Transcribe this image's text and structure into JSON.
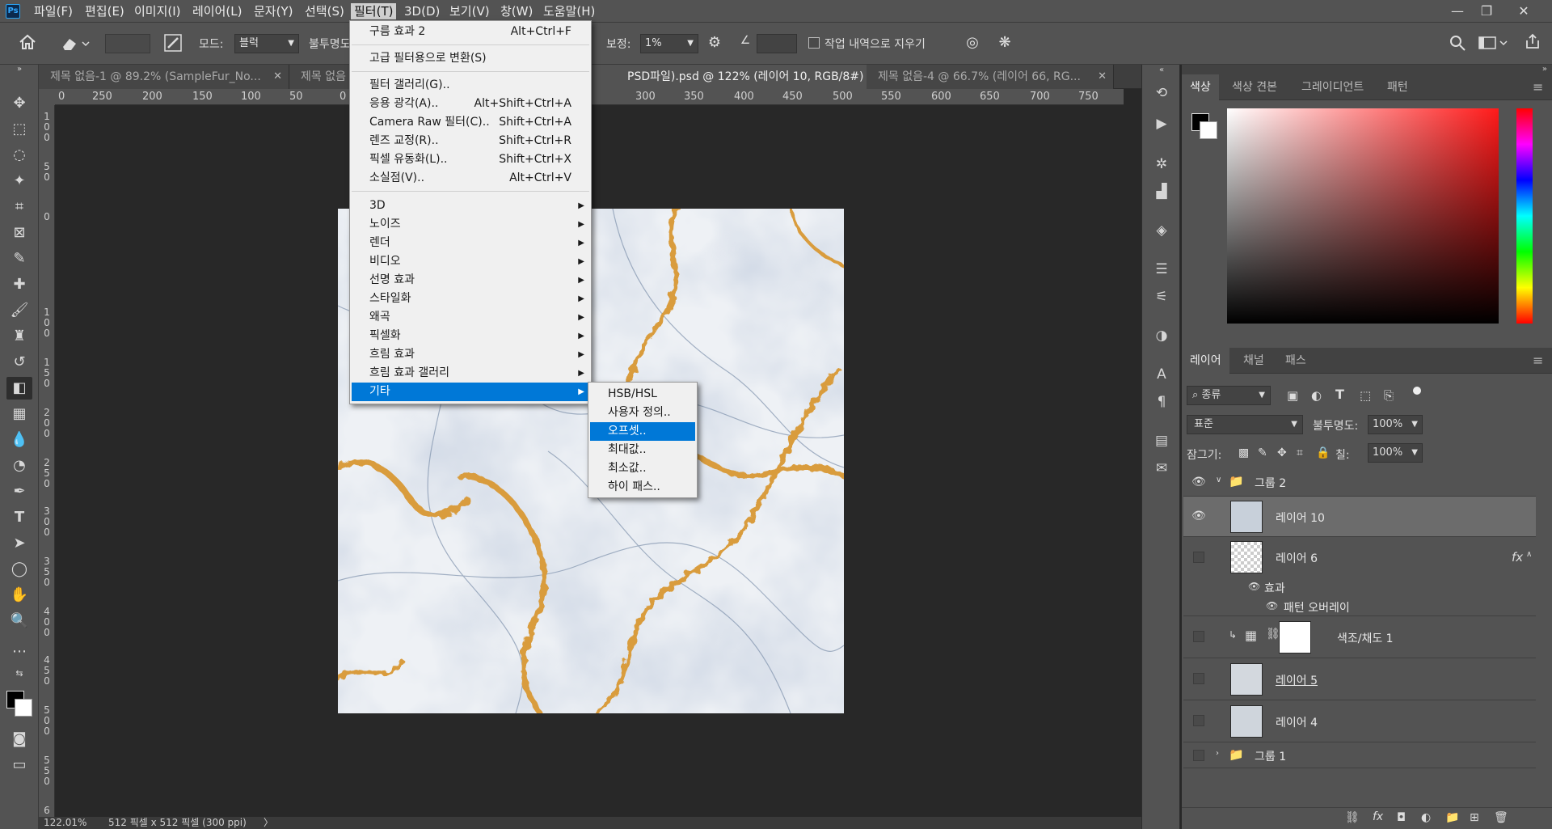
{
  "app": {
    "logo": "Ps"
  },
  "menubar": {
    "items": [
      "파일(F)",
      "편집(E)",
      "이미지(I)",
      "레이어(L)",
      "문자(Y)",
      "선택(S)",
      "필터(T)",
      "3D(D)",
      "보기(V)",
      "창(W)",
      "도움말(H)"
    ],
    "active_index": 6
  },
  "window_controls": {
    "minimize": "—",
    "restore": "❐",
    "close": "✕"
  },
  "options": {
    "mode_label": "모드:",
    "mode_value": "블럭",
    "opacity_label": "불투명도",
    "smoothing_label": "보정:",
    "smoothing_value": "1%",
    "erase_history_label": "작업 내역으로 지우기"
  },
  "tabs": [
    {
      "label": "제목 없음-1 @ 89.2% (SampleFur_No...",
      "active": false
    },
    {
      "label": "제목 없음",
      "active": false
    },
    {
      "label": "PSD파일).psd @ 122% (레이어 10, RGB/8#) *",
      "active": true
    },
    {
      "label": "제목 없음-4 @ 66.7% (레이어 66, RG...",
      "active": false
    }
  ],
  "ruler": {
    "h_labels": [
      "0",
      "250",
      "200",
      "150",
      "100",
      "50",
      "0",
      "300",
      "350",
      "400",
      "450",
      "500",
      "550",
      "600",
      "650",
      "700",
      "750"
    ],
    "v_labels": [
      "100",
      "50",
      "0",
      "100",
      "150",
      "200",
      "250",
      "300",
      "350",
      "400",
      "450",
      "500",
      "550",
      "6"
    ]
  },
  "status": {
    "zoom": "122.01%",
    "doc_info": "512 픽셀 x 512 픽셀 (300 ppi)",
    "arrow": "〉"
  },
  "filter_menu": {
    "items": [
      {
        "label": "구름 효과 2",
        "shortcut": "Alt+Ctrl+F"
      },
      {
        "sep": true
      },
      {
        "label": "고급 필터용으로 변환(S)",
        "shortcut": ""
      },
      {
        "sep": true
      },
      {
        "label": "필터 갤러리(G)..",
        "shortcut": ""
      },
      {
        "label": "응용 광각(A)..",
        "shortcut": "Alt+Shift+Ctrl+A"
      },
      {
        "label": "Camera Raw 필터(C)..",
        "shortcut": "Shift+Ctrl+A"
      },
      {
        "label": "렌즈 교정(R)..",
        "shortcut": "Shift+Ctrl+R"
      },
      {
        "label": "픽셀 유동화(L)..",
        "shortcut": "Shift+Ctrl+X"
      },
      {
        "label": "소실점(V)..",
        "shortcut": "Alt+Ctrl+V"
      },
      {
        "sep": true
      },
      {
        "label": "3D",
        "sub": true
      },
      {
        "label": "노이즈",
        "sub": true
      },
      {
        "label": "렌더",
        "sub": true
      },
      {
        "label": "비디오",
        "sub": true
      },
      {
        "label": "선명 효과",
        "sub": true
      },
      {
        "label": "스타일화",
        "sub": true
      },
      {
        "label": "왜곡",
        "sub": true
      },
      {
        "label": "픽셀화",
        "sub": true
      },
      {
        "label": "흐림 효과",
        "sub": true
      },
      {
        "label": "흐림 효과 갤러리",
        "sub": true
      },
      {
        "label": "기타",
        "sub": true,
        "highlight": true
      }
    ]
  },
  "submenu": {
    "items": [
      "HSB/HSL",
      "사용자 정의..",
      "오프셋..",
      "최대값..",
      "최소값..",
      "하이 패스.."
    ],
    "highlight_index": 2
  },
  "color_panel": {
    "tabs": [
      "색상",
      "색상 견본",
      "그레이디언트",
      "패턴"
    ],
    "fg": "#000000",
    "bg": "#ffffff"
  },
  "layers_panel": {
    "tabs": [
      "레이어",
      "채널",
      "패스"
    ],
    "kind_label": "종류",
    "blend_mode": "표준",
    "opacity_label": "불투명도:",
    "opacity_value": "100%",
    "lock_label": "잠그기:",
    "fill_label": "칠:",
    "fill_value": "100%",
    "fx_label": "fx",
    "layers": [
      {
        "name": "그룹 2",
        "type": "group",
        "visible": true
      },
      {
        "name": "레이어 10",
        "type": "layer",
        "visible": true,
        "selected": true
      },
      {
        "name": "레이어 6",
        "type": "layer",
        "visible": false
      },
      {
        "name": "효과",
        "type": "effect"
      },
      {
        "name": "패턴 오버레이",
        "type": "effect-item"
      },
      {
        "name": "색조/채도 1",
        "type": "adjustment",
        "visible": false
      },
      {
        "name": "레이어 5",
        "type": "layer",
        "visible": false
      },
      {
        "name": "레이어 4",
        "type": "layer",
        "visible": false
      },
      {
        "name": "그룹 1",
        "type": "group",
        "visible": false
      }
    ]
  }
}
